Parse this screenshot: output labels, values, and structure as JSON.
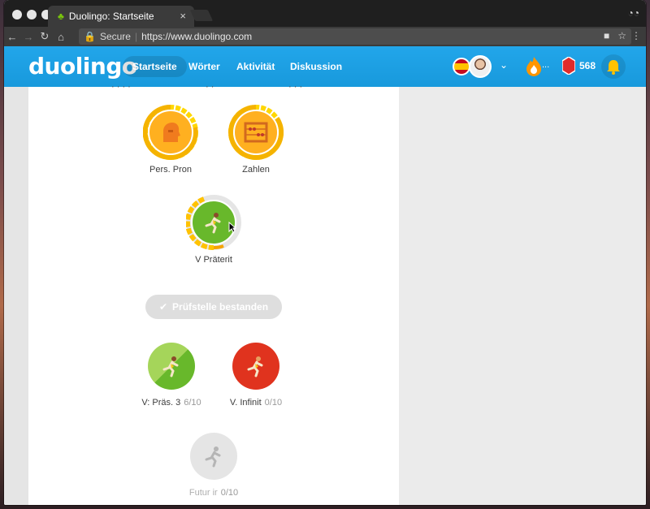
{
  "browser": {
    "tab_title": "Duolingo: Startseite",
    "secure_label": "Secure",
    "url": "https://www.duolingo.com"
  },
  "header": {
    "logo": "duolingo",
    "nav": [
      {
        "label": "Startseite",
        "active": true
      },
      {
        "label": "Wörter",
        "active": false
      },
      {
        "label": "Aktivität",
        "active": false
      },
      {
        "label": "Diskussion",
        "active": false
      }
    ],
    "streak": "...",
    "gems": "568",
    "colors": {
      "header": "#1cb0f6",
      "gold": "#ffc200",
      "green": "#78c800",
      "red": "#e53838"
    }
  },
  "skills": [
    {
      "name": "Pers. Pron",
      "progress": "",
      "color": "gold",
      "icon": "bust-icon"
    },
    {
      "name": "Zahlen",
      "progress": "",
      "color": "gold",
      "icon": "abacus-icon"
    },
    {
      "name": "V Präterit",
      "progress": "",
      "color": "green",
      "icon": "runner-icon"
    },
    {
      "name": "V: Präs. 3",
      "progress": "6/10",
      "color": "green-half",
      "icon": "runner-icon"
    },
    {
      "name": "V. Infinit",
      "progress": "0/10",
      "color": "red",
      "icon": "runner-icon"
    },
    {
      "name": "Futur ir",
      "progress": "0/10",
      "color": "locked",
      "icon": "runner-icon"
    }
  ],
  "checkpoint": {
    "label": "Prüfstelle bestanden"
  }
}
